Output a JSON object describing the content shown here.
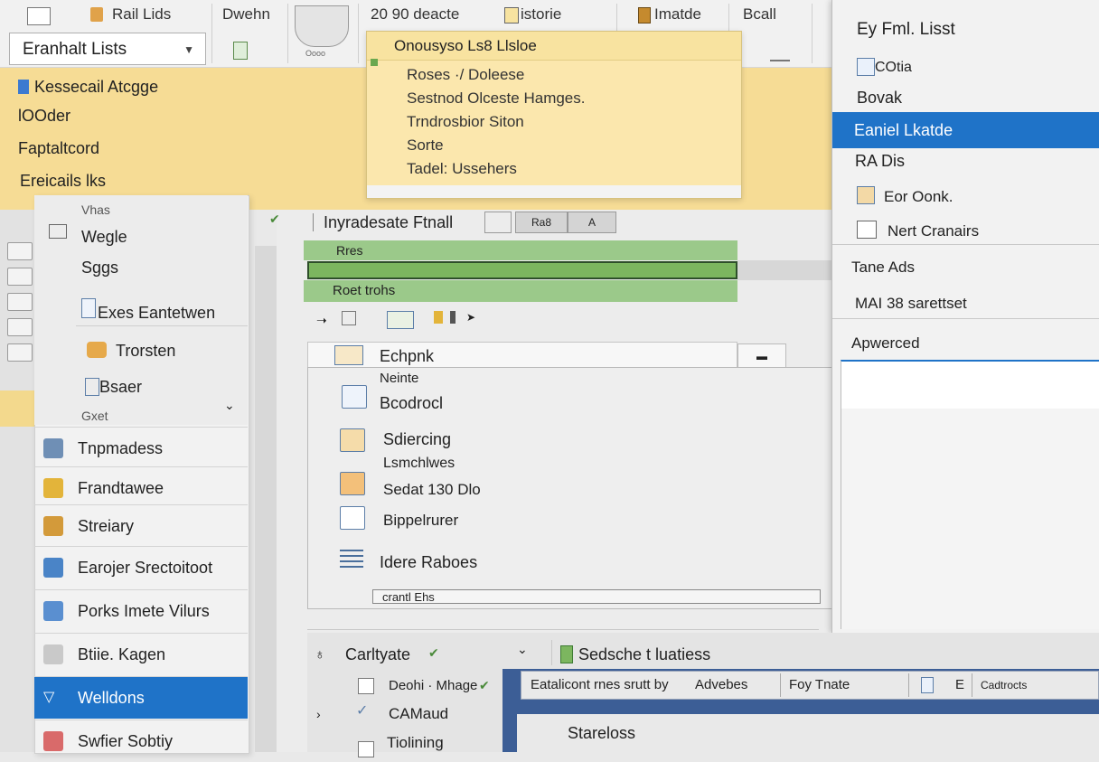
{
  "ribbon": {
    "items": [
      {
        "label": "Rail Lids",
        "icon": "list-icon"
      },
      {
        "label": "Dwehn"
      },
      {
        "label": "20 90 deacte"
      },
      {
        "label": "istorie",
        "icon": "document-icon"
      },
      {
        "label": "Imatde",
        "icon": "clipboard-icon"
      },
      {
        "label": "Bcall"
      }
    ],
    "combo_value": "Eranhalt Lists",
    "shape_caption": "Oooo",
    "left_items": [
      "Kessecail Atcgge",
      "lOOder",
      "Faptaltcord",
      "Ereicails lks"
    ]
  },
  "dropdown": {
    "header": "Onousyso Ls8 Llsloe",
    "items": [
      "Roses ·/ Doleese",
      "Sestnod Olceste Hamges.",
      "Trndrosbior Siton",
      "Sorte",
      "Tadel: Ussehers"
    ]
  },
  "left_panel": {
    "upper_items": [
      "Vhas",
      "Wegle",
      "Sggs",
      "Exes Eantetwen",
      "Trorsten",
      "Bsaer",
      "Gxet"
    ],
    "rows": [
      {
        "label": "Tnpmadess",
        "icon_color": "#6f8fb5"
      },
      {
        "label": "Frandtawee",
        "icon_color": "#e3b43a"
      },
      {
        "label": "Streiary",
        "icon_color": "#d39a3a"
      },
      {
        "label": "Earojer Srectoitoot",
        "icon_color": "#4a84c7"
      },
      {
        "label": "Porks Imete Vilurs",
        "icon_color": "#5a8fd0"
      },
      {
        "label": "Btiie. Kagen",
        "icon_color": "#c9c9c9"
      },
      {
        "label": "Welldons",
        "icon_color": "#ffffff",
        "selected": true
      },
      {
        "label": "Swfier Sobtiy",
        "icon_color": "#d96a6a"
      }
    ]
  },
  "center": {
    "title": "Inyradesate Ftnall",
    "tool_a": "Ra8",
    "tool_b": "A",
    "green_header": "Rres",
    "green_footer": "Roet trohs",
    "list_header": "Echpnk",
    "list_sub": "Neinte",
    "list_items": [
      "Bcodrocl",
      "Sdiercing",
      "Lsmchlwes",
      "Sedat 130 Dlo",
      "Bippelrurer",
      "Idere Raboes"
    ],
    "footer_field": "crantl Ehs"
  },
  "right_panel": {
    "title": "Ey Fml. Lisst",
    "items": [
      "COtia",
      "Bovak",
      "Eaniel Lkatde",
      "RA Dis",
      "Eor Oonk.",
      "Nert Cranairs",
      "Tane Ads",
      "MAI 38 sarettset"
    ],
    "selected_index": 2,
    "advanced_label": "Apwerced"
  },
  "bottom": {
    "col_left_label": "Carltyate",
    "col_right_label": "Sedsche t luatiess",
    "checks": [
      "Deohi · Mhage",
      "CAMaud",
      "Tiolining"
    ],
    "dialog_bar": [
      "Eatalicont rnes srutt by",
      "Advebes",
      "Foy Tnate",
      "E",
      "Cadtrocts"
    ],
    "dialog_body": "Stareloss"
  }
}
